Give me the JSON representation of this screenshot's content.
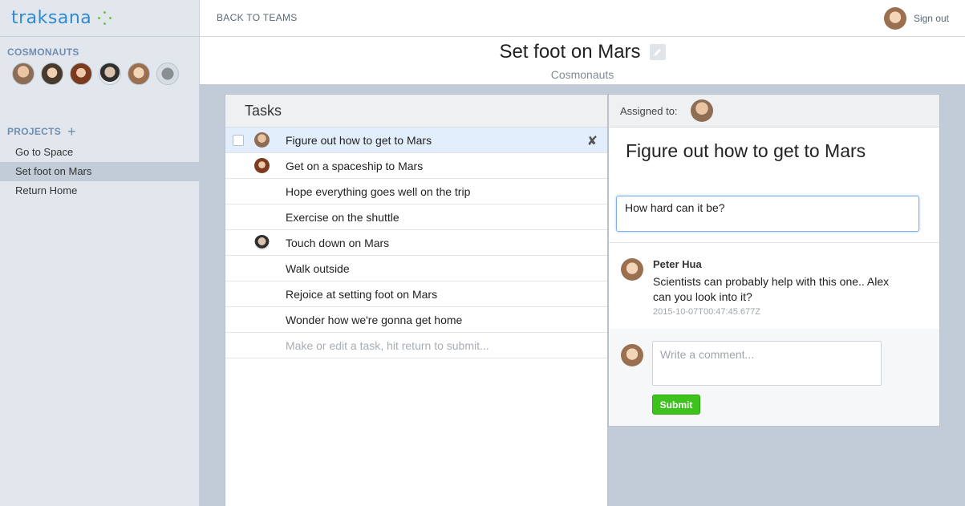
{
  "app": {
    "name": "traksana"
  },
  "topbar": {
    "back_label": "BACK TO TEAMS",
    "signout_label": "Sign out"
  },
  "sidebar": {
    "team_title": "COSMONAUTS",
    "members": [
      "member-1",
      "member-2",
      "member-3",
      "member-4",
      "member-5",
      "member-6"
    ],
    "projects_title": "PROJECTS",
    "projects": [
      {
        "label": "Go to Space",
        "active": false
      },
      {
        "label": "Set foot on Mars",
        "active": true
      },
      {
        "label": "Return Home",
        "active": false
      }
    ]
  },
  "project": {
    "title": "Set foot on Mars",
    "subtitle": "Cosmonauts"
  },
  "tasks": {
    "heading": "Tasks",
    "items": [
      {
        "label": "Figure out how to get to Mars"
      },
      {
        "label": "Get on a spaceship to Mars"
      },
      {
        "label": "Hope everything goes well on the trip"
      },
      {
        "label": "Exercise on the shuttle"
      },
      {
        "label": "Touch down on Mars"
      },
      {
        "label": "Walk outside"
      },
      {
        "label": "Rejoice at setting foot on Mars"
      },
      {
        "label": "Wonder how we're gonna get home"
      }
    ],
    "new_placeholder": "Make or edit a task, hit return to submit..."
  },
  "detail": {
    "assigned_label": "Assigned to:",
    "title": "Figure out how to get to Mars",
    "note_value": "How hard can it be?",
    "comments": [
      {
        "author": "Peter Hua",
        "text": "Scientists can probably help with this one.. Alex can you look into it?",
        "timestamp": "2015-10-07T00:47:45.677Z"
      }
    ],
    "comment_placeholder": "Write a comment...",
    "submit_label": "Submit"
  },
  "icons": {
    "plus": "plus-icon",
    "edit": "pencil-icon",
    "delete": "x-icon"
  },
  "colors": {
    "brand": "#2e8bd0",
    "accent_green": "#3ec21d",
    "sidebar_bg": "#e2e7ed",
    "selected_row": "#e2eefc",
    "main_bg": "#c2ccd8"
  }
}
